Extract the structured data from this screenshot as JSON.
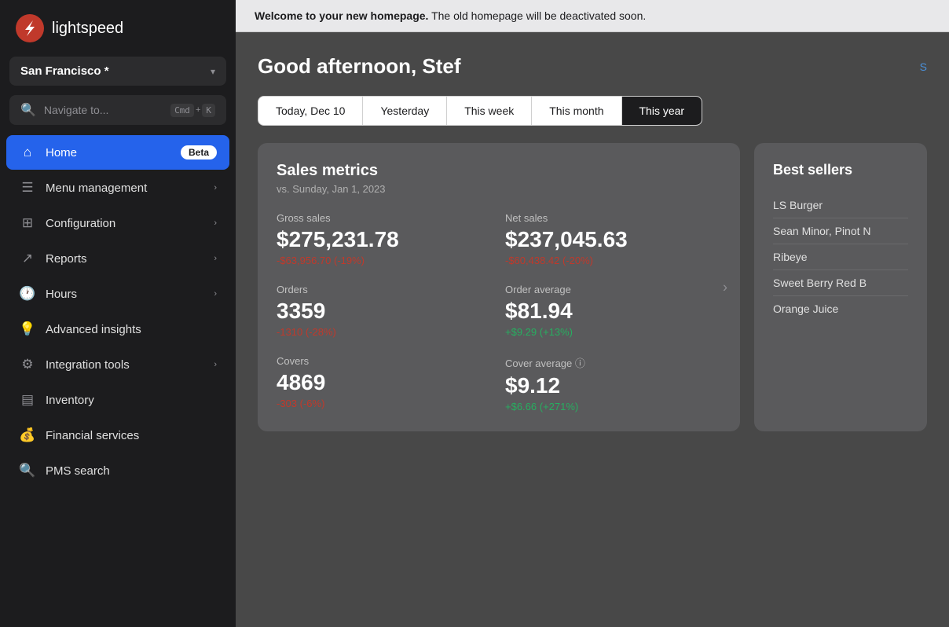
{
  "sidebar": {
    "logo_text": "lightspeed",
    "location": "San Francisco *",
    "search_placeholder": "Navigate to...",
    "shortcut_cmd": "Cmd",
    "shortcut_plus": "+",
    "shortcut_key": "K",
    "nav_items": [
      {
        "id": "home",
        "label": "Home",
        "badge": "Beta",
        "active": true,
        "has_arrow": false
      },
      {
        "id": "menu-management",
        "label": "Menu management",
        "active": false,
        "has_arrow": true
      },
      {
        "id": "configuration",
        "label": "Configuration",
        "active": false,
        "has_arrow": true
      },
      {
        "id": "reports",
        "label": "Reports",
        "active": false,
        "has_arrow": true
      },
      {
        "id": "hours",
        "label": "Hours",
        "active": false,
        "has_arrow": true
      },
      {
        "id": "advanced-insights",
        "label": "Advanced insights",
        "active": false,
        "has_arrow": false
      },
      {
        "id": "integration-tools",
        "label": "Integration tools",
        "active": false,
        "has_arrow": true
      },
      {
        "id": "inventory",
        "label": "Inventory",
        "active": false,
        "has_arrow": false
      },
      {
        "id": "financial-services",
        "label": "Financial services",
        "active": false,
        "has_arrow": false
      },
      {
        "id": "pms-search",
        "label": "PMS search",
        "active": false,
        "has_arrow": false
      }
    ]
  },
  "banner": {
    "bold_text": "Welcome to your new homepage.",
    "rest_text": " The old homepage will be deactivated soon."
  },
  "header": {
    "greeting": "Good afternoon, Stef",
    "setup_link": "S"
  },
  "time_tabs": [
    {
      "id": "today",
      "label": "Today, Dec 10",
      "active": false
    },
    {
      "id": "yesterday",
      "label": "Yesterday",
      "active": false
    },
    {
      "id": "this-week",
      "label": "This week",
      "active": false
    },
    {
      "id": "this-month",
      "label": "This month",
      "active": false
    },
    {
      "id": "this-year",
      "label": "This year",
      "active": true
    }
  ],
  "sales_metrics": {
    "title": "Sales metrics",
    "subtitle": "vs. Sunday, Jan 1, 2023",
    "metrics": [
      {
        "id": "gross-sales",
        "label": "Gross sales",
        "value": "$275,231.78",
        "delta": "-$63,956.70 (-19%)",
        "positive": false
      },
      {
        "id": "net-sales",
        "label": "Net sales",
        "value": "$237,045.63",
        "delta": "-$60,438.42 (-20%)",
        "positive": false
      },
      {
        "id": "orders",
        "label": "Orders",
        "value": "3359",
        "delta": "-1310 (-28%)",
        "positive": false
      },
      {
        "id": "order-average",
        "label": "Order average",
        "value": "$81.94",
        "delta": "+$9.29 (+13%)",
        "positive": true
      },
      {
        "id": "covers",
        "label": "Covers",
        "value": "4869",
        "delta": "-303 (-6%)",
        "positive": false
      },
      {
        "id": "cover-average",
        "label": "Cover average ⓘ",
        "value": "$9.12",
        "delta": "+$6.66 (+271%)",
        "positive": true
      }
    ]
  },
  "best_sellers": {
    "title": "Best sellers",
    "items": [
      "LS Burger",
      "Sean Minor, Pinot N",
      "Ribeye",
      "Sweet Berry Red B",
      "Orange Juice"
    ]
  }
}
